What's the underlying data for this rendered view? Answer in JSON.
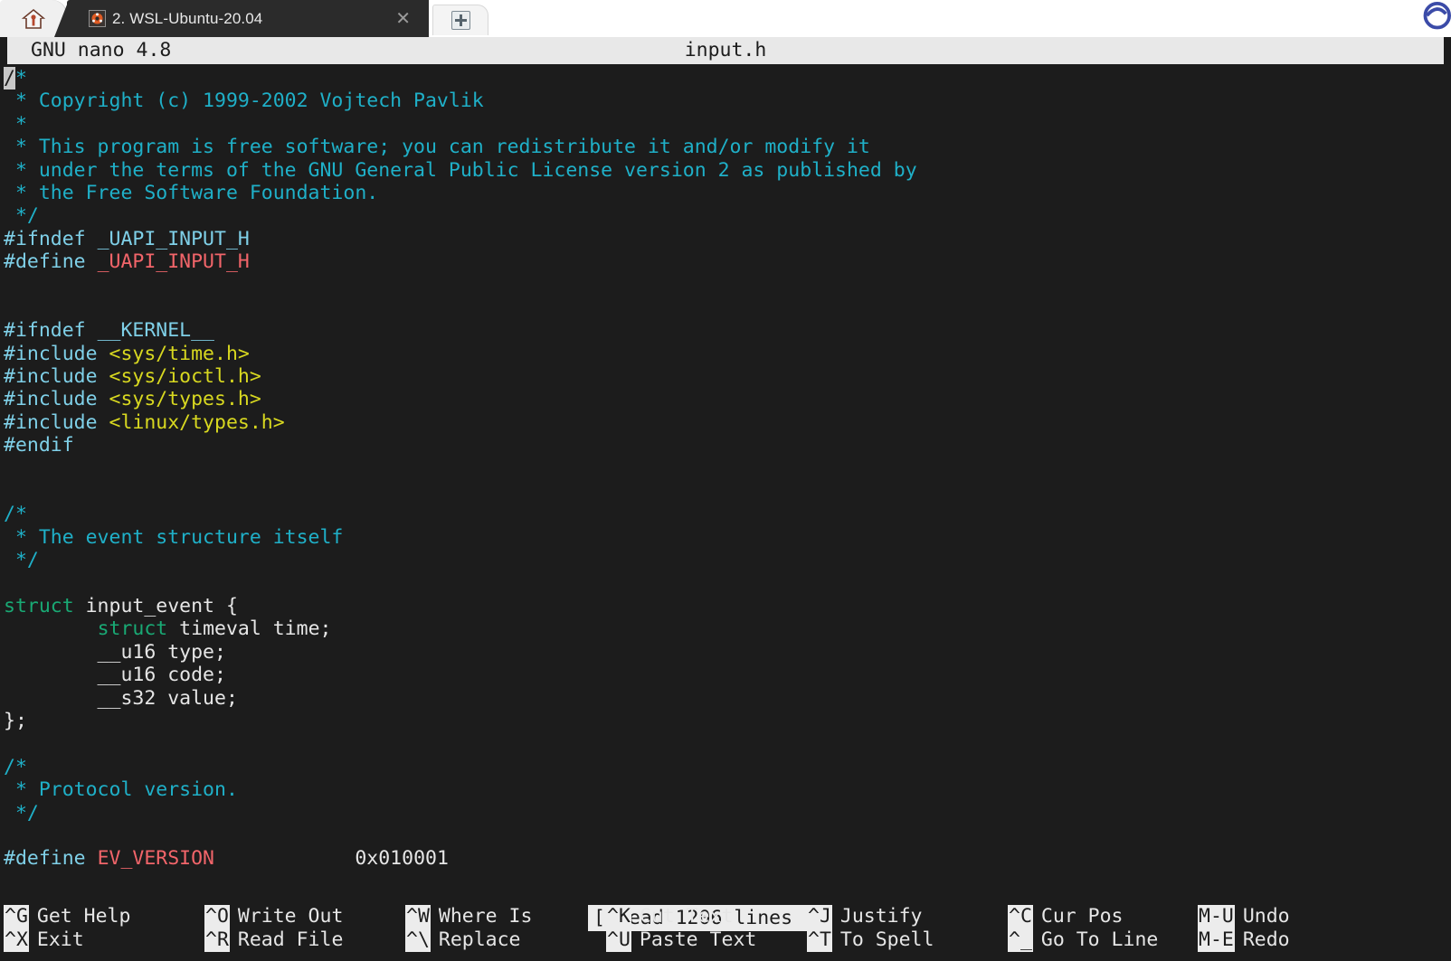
{
  "window": {
    "home_tab_icon": "home-icon",
    "attachment_icon": "edge-badge-icon",
    "tabs": [
      {
        "favicon": "ubuntu-icon",
        "title": "2. WSL-Ubuntu-20.04",
        "close_label": "✕"
      }
    ],
    "new_tab_label": "new-tab-plus"
  },
  "nano": {
    "version_label": "GNU nano 4.8",
    "filename": "input.h",
    "status_message": "[ Read 1206 lines ]",
    "colors": {
      "background": "#1c1c1c",
      "comment": "#1fb0c8",
      "preprocessor": "#7fd0e8",
      "define_name": "#f2656a",
      "include_path": "#d8d820",
      "keyword": "#19a974",
      "plain": "#e6e6e6",
      "titlebar_bg": "#e8e8e8",
      "titlebar_fg": "#1c1c1c"
    },
    "buffer_lines": [
      [
        {
          "t": "/",
          "c": "cursor"
        },
        {
          "t": "*",
          "c": "c-comment"
        }
      ],
      [
        {
          "t": " * Copyright (c) 1999-2002 Vojtech Pavlik",
          "c": "c-comment"
        }
      ],
      [
        {
          "t": " *",
          "c": "c-comment"
        }
      ],
      [
        {
          "t": " * This program is free software; you can redistribute it and/or modify it",
          "c": "c-comment"
        }
      ],
      [
        {
          "t": " * under the terms of the GNU General Public License version 2 as published by",
          "c": "c-comment"
        }
      ],
      [
        {
          "t": " * the Free Software Foundation.",
          "c": "c-comment"
        }
      ],
      [
        {
          "t": " */",
          "c": "c-comment"
        }
      ],
      [
        {
          "t": "#ifndef ",
          "c": "c-pre"
        },
        {
          "t": "_UAPI_INPUT_H",
          "c": "c-pre"
        }
      ],
      [
        {
          "t": "#define ",
          "c": "c-pre"
        },
        {
          "t": "_UAPI_INPUT_H",
          "c": "c-def"
        }
      ],
      [
        {
          "t": "",
          "c": "c-plain"
        }
      ],
      [
        {
          "t": "",
          "c": "c-plain"
        }
      ],
      [
        {
          "t": "#ifndef ",
          "c": "c-pre"
        },
        {
          "t": "__KERNEL__",
          "c": "c-pre"
        }
      ],
      [
        {
          "t": "#include ",
          "c": "c-pre"
        },
        {
          "t": "<sys/time.h>",
          "c": "c-inc"
        }
      ],
      [
        {
          "t": "#include ",
          "c": "c-pre"
        },
        {
          "t": "<sys/ioctl.h>",
          "c": "c-inc"
        }
      ],
      [
        {
          "t": "#include ",
          "c": "c-pre"
        },
        {
          "t": "<sys/types.h>",
          "c": "c-inc"
        }
      ],
      [
        {
          "t": "#include ",
          "c": "c-pre"
        },
        {
          "t": "<linux/types.h>",
          "c": "c-inc"
        }
      ],
      [
        {
          "t": "#endif",
          "c": "c-pre"
        }
      ],
      [
        {
          "t": "",
          "c": "c-plain"
        }
      ],
      [
        {
          "t": "",
          "c": "c-plain"
        }
      ],
      [
        {
          "t": "/*",
          "c": "c-comment"
        }
      ],
      [
        {
          "t": " * The event structure itself",
          "c": "c-comment"
        }
      ],
      [
        {
          "t": " */",
          "c": "c-comment"
        }
      ],
      [
        {
          "t": "",
          "c": "c-plain"
        }
      ],
      [
        {
          "t": "struct",
          "c": "c-kw"
        },
        {
          "t": " input_event {",
          "c": "c-plain"
        }
      ],
      [
        {
          "t": "        ",
          "c": "c-plain"
        },
        {
          "t": "struct",
          "c": "c-kw"
        },
        {
          "t": " timeval time;",
          "c": "c-plain"
        }
      ],
      [
        {
          "t": "        __u16 type;",
          "c": "c-plain"
        }
      ],
      [
        {
          "t": "        __u16 code;",
          "c": "c-plain"
        }
      ],
      [
        {
          "t": "        __s32 value;",
          "c": "c-plain"
        }
      ],
      [
        {
          "t": "};",
          "c": "c-plain"
        }
      ],
      [
        {
          "t": "",
          "c": "c-plain"
        }
      ],
      [
        {
          "t": "/*",
          "c": "c-comment"
        }
      ],
      [
        {
          "t": " * Protocol version.",
          "c": "c-comment"
        }
      ],
      [
        {
          "t": " */",
          "c": "c-comment"
        }
      ],
      [
        {
          "t": "",
          "c": "c-plain"
        }
      ],
      [
        {
          "t": "#define ",
          "c": "c-pre"
        },
        {
          "t": "EV_VERSION",
          "c": "c-def"
        },
        {
          "t": "            0x010001",
          "c": "c-plain"
        }
      ]
    ],
    "shortcuts_row1": [
      {
        "key": "^G",
        "label": "Get Help"
      },
      {
        "key": "^O",
        "label": "Write Out"
      },
      {
        "key": "^W",
        "label": "Where Is"
      },
      {
        "key": "^K",
        "label": "Cut Text"
      },
      {
        "key": "^J",
        "label": "Justify"
      },
      {
        "key": "^C",
        "label": "Cur Pos"
      },
      {
        "key": "M-U",
        "label": "Undo"
      }
    ],
    "shortcuts_row2": [
      {
        "key": "^X",
        "label": "Exit"
      },
      {
        "key": "^R",
        "label": "Read File"
      },
      {
        "key": "^\\",
        "label": "Replace"
      },
      {
        "key": "^U",
        "label": "Paste Text"
      },
      {
        "key": "^T",
        "label": "To Spell"
      },
      {
        "key": "^_",
        "label": "Go To Line"
      },
      {
        "key": "M-E",
        "label": "Redo"
      }
    ]
  }
}
